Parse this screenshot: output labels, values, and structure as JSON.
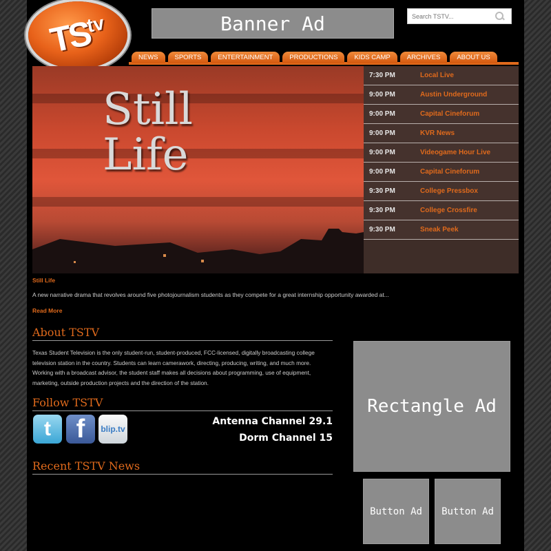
{
  "logo": {
    "text": "TS",
    "tv": "tv"
  },
  "banner_ad": {
    "label": "Banner Ad"
  },
  "search": {
    "placeholder": "Search TSTV..."
  },
  "nav": {
    "items": [
      {
        "label": "NEWS"
      },
      {
        "label": "SPORTS"
      },
      {
        "label": "ENTERTAINMENT"
      },
      {
        "label": "PRODUCTIONS"
      },
      {
        "label": "KIDS CAMP"
      },
      {
        "label": "ARCHIVES"
      },
      {
        "label": "ABOUT US"
      }
    ]
  },
  "hero": {
    "title_line1": "Still",
    "title_line2": "Life",
    "caption": "Still Life",
    "description": "A new narrative drama that revolves around five photojournalism students as they compete for a great internship opportunity awarded at...",
    "read_more": "Read More"
  },
  "schedule": [
    {
      "time": "7:30 PM",
      "show": "Local Live"
    },
    {
      "time": "9:00 PM",
      "show": "Austin Underground"
    },
    {
      "time": "9:00 PM",
      "show": "Capital Cineforum"
    },
    {
      "time": "9:00 PM",
      "show": "KVR News"
    },
    {
      "time": "9:00 PM",
      "show": "Videogame Hour Live"
    },
    {
      "time": "9:00 PM",
      "show": "Capital Cineforum"
    },
    {
      "time": "9:30 PM",
      "show": "College Pressbox"
    },
    {
      "time": "9:30 PM",
      "show": "College Crossfire"
    },
    {
      "time": "9:30 PM",
      "show": "Sneak Peek"
    }
  ],
  "about": {
    "heading": "About TSTV",
    "text": "Texas Student Television is the only student-run, student-produced, FCC-licensed, digitally broadcasting college television station in the country. Students can learn camerawork, directing, producing, writing, and much more. Working with a broadcast advisor, the student staff makes all decisions about programming, use of equipment, marketing, outside production projects and the direction of the station."
  },
  "follow": {
    "heading": "Follow TSTV",
    "twitter_glyph": "t",
    "facebook_glyph": "f",
    "bliptv_glyph": "blip.tv",
    "antenna_channel": "Antenna Channel 29.1",
    "dorm_channel": "Dorm Channel 15"
  },
  "news": {
    "heading": "Recent TSTV News"
  },
  "ads": {
    "rectangle": "Rectangle Ad",
    "button1": "Button Ad",
    "button2": "Button Ad"
  },
  "colors": {
    "accent": "#e06a1c",
    "ad_gray": "#8c8c8c",
    "background": "#000000"
  }
}
